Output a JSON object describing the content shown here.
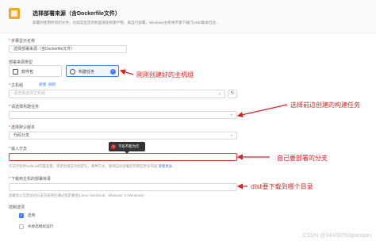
{
  "header": {
    "title": "选择部署来源（含Dockerfile文件）",
    "description": "部署时使用所有的文件，也就是是定的制品或在构建产物，来自行部署，Windows主机将不需下载门1490版本包括..."
  },
  "form": {
    "name": {
      "label": "步骤显示名称",
      "value": "选择部署来源（含Dockerfile文件）"
    },
    "source_type": {
      "label": "部署来源类型",
      "options": [
        {
          "label": "软件包",
          "icon": "package-icon",
          "active": false
        },
        {
          "label": "构建任务",
          "icon": "build-icon",
          "active": true
        }
      ]
    },
    "host_group": {
      "label": "主机组",
      "links": [
        "新建",
        "刷新"
      ],
      "placeholder": "请选择选择主机组",
      "refresh_icon": "refresh-icon"
    },
    "build_task": {
      "label": "请选择构建任务",
      "value": ""
    },
    "default_version": {
      "label": "选择默认版本",
      "value": "代码分支"
    },
    "branch": {
      "label": "输入分支",
      "value": "",
      "hint": "仅支持使用selfbuild内置变量，或者直接支持指定在，两种方式，能够自动部署您的那些更多内容",
      "hint_more": "查看更多"
    },
    "download_dir": {
      "label": "下载到主机的部署目录",
      "value": "",
      "hint": "部署会以实际访问分支内容将在通过指定路径(Linux: /tem/local，Windows: C:/Windows)"
    },
    "advanced": {
      "label": "控制选项",
      "checkboxes": [
        {
          "label": "启用",
          "checked": true
        },
        {
          "label": "失败后继续运行",
          "checked": false
        }
      ]
    }
  },
  "tooltip": {
    "text": "字段不能为空",
    "icon": "error-icon"
  },
  "annotations": {
    "host": "刚刚创建好的主机组",
    "build": "选择前边创建的构建任务",
    "branch": "自己要部署的分支",
    "dist": "dist要下载到哪个目录"
  },
  "watermark": "CSDN @34009750qianqian",
  "colors": {
    "accent": "#3b7cff",
    "error": "#e03a3a",
    "annotation": "#e02020",
    "logo": "#f5a623"
  }
}
